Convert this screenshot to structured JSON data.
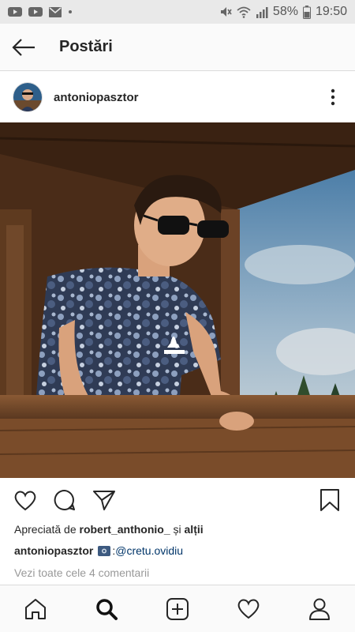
{
  "status_bar": {
    "battery": "58%",
    "time": "19:50",
    "icons": [
      "youtube-icon",
      "youtube-icon",
      "gmail-icon",
      "dot-icon",
      "mute-icon",
      "wifi-icon",
      "signal-icon",
      "battery-icon"
    ]
  },
  "header": {
    "title": "Postări",
    "back_icon": "arrow-left-icon"
  },
  "post": {
    "username": "antoniopasztor",
    "likes_prefix": "Apreciată de ",
    "likes_user": "robert_anthonio_",
    "likes_suffix": " și ",
    "likes_others": "alții",
    "caption_user": "antoniopasztor",
    "caption_sep": ": ",
    "caption_mention": "@cretu.ovidiu",
    "comments_link": "Vezi toate cele 4 comentarii"
  },
  "bottom_nav": {
    "items": [
      "home-icon",
      "search-icon",
      "add-icon",
      "heart-icon",
      "profile-icon"
    ]
  },
  "colors": {
    "text": "#262626",
    "muted": "#999999",
    "link": "#003569",
    "border": "#dbdbdb"
  }
}
